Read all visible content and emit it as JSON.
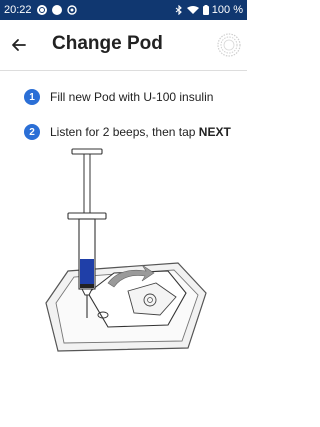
{
  "status_bar": {
    "time": "20:22",
    "battery": "100 %"
  },
  "header": {
    "title": "Change Pod",
    "back_icon": "arrow-left-icon",
    "pod_icon": "pod-status-ring-icon"
  },
  "steps": [
    {
      "number": "1",
      "text": "Fill new Pod with U-100 insulin"
    },
    {
      "number": "2",
      "text": "Listen for 2 beeps, then tap ",
      "emphasis": "NEXT"
    }
  ],
  "illustration": {
    "description_icon": "syringe-filling-pod-illustration",
    "insulin_color": "#1f3fa8"
  },
  "colors": {
    "status_bar": "#103770",
    "accent": "#2b6fd6"
  }
}
